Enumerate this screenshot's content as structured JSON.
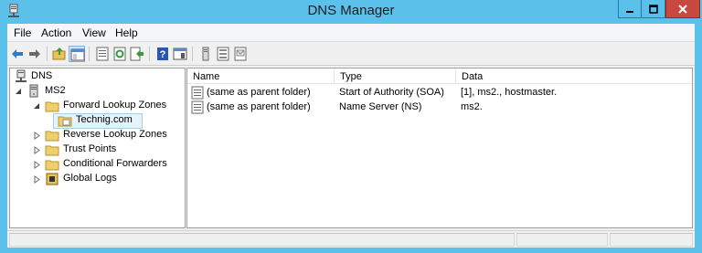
{
  "window": {
    "title": "DNS Manager"
  },
  "menu": [
    "File",
    "Action",
    "View",
    "Help"
  ],
  "toolbar": [
    {
      "name": "back-arrow-icon",
      "interactable": true
    },
    {
      "name": "forward-arrow-icon",
      "interactable": true
    },
    {
      "name": "up-folder-icon",
      "interactable": true
    },
    {
      "name": "show-hide-tree-icon",
      "interactable": true
    },
    {
      "name": "properties-icon",
      "interactable": true
    },
    {
      "name": "refresh-icon",
      "interactable": true
    },
    {
      "name": "export-list-icon",
      "interactable": true
    },
    {
      "name": "help-icon",
      "interactable": true
    },
    {
      "name": "show-hide-action-pane-icon",
      "interactable": true
    },
    {
      "name": "new-host-icon",
      "interactable": true
    },
    {
      "name": "new-alias-icon",
      "interactable": true
    },
    {
      "name": "new-mail-exchanger-icon",
      "interactable": true
    }
  ],
  "tree": {
    "root": "DNS",
    "server": "MS2",
    "items": [
      {
        "label": "Forward Lookup Zones",
        "expanded": true
      },
      {
        "label": "Technig.com",
        "selected": true
      },
      {
        "label": "Reverse Lookup Zones"
      },
      {
        "label": "Trust Points"
      },
      {
        "label": "Conditional Forwarders"
      },
      {
        "label": "Global Logs"
      }
    ]
  },
  "list": {
    "columns": [
      "Name",
      "Type",
      "Data"
    ],
    "rows": [
      {
        "name": "(same as parent folder)",
        "type": "Start of Authority (SOA)",
        "data": "[1], ms2., hostmaster."
      },
      {
        "name": "(same as parent folder)",
        "type": "Name Server (NS)",
        "data": "ms2."
      }
    ]
  },
  "colors": {
    "titlebar": "#5bc0ea",
    "close": "#c7483f",
    "selection": "#e5f3fb"
  }
}
